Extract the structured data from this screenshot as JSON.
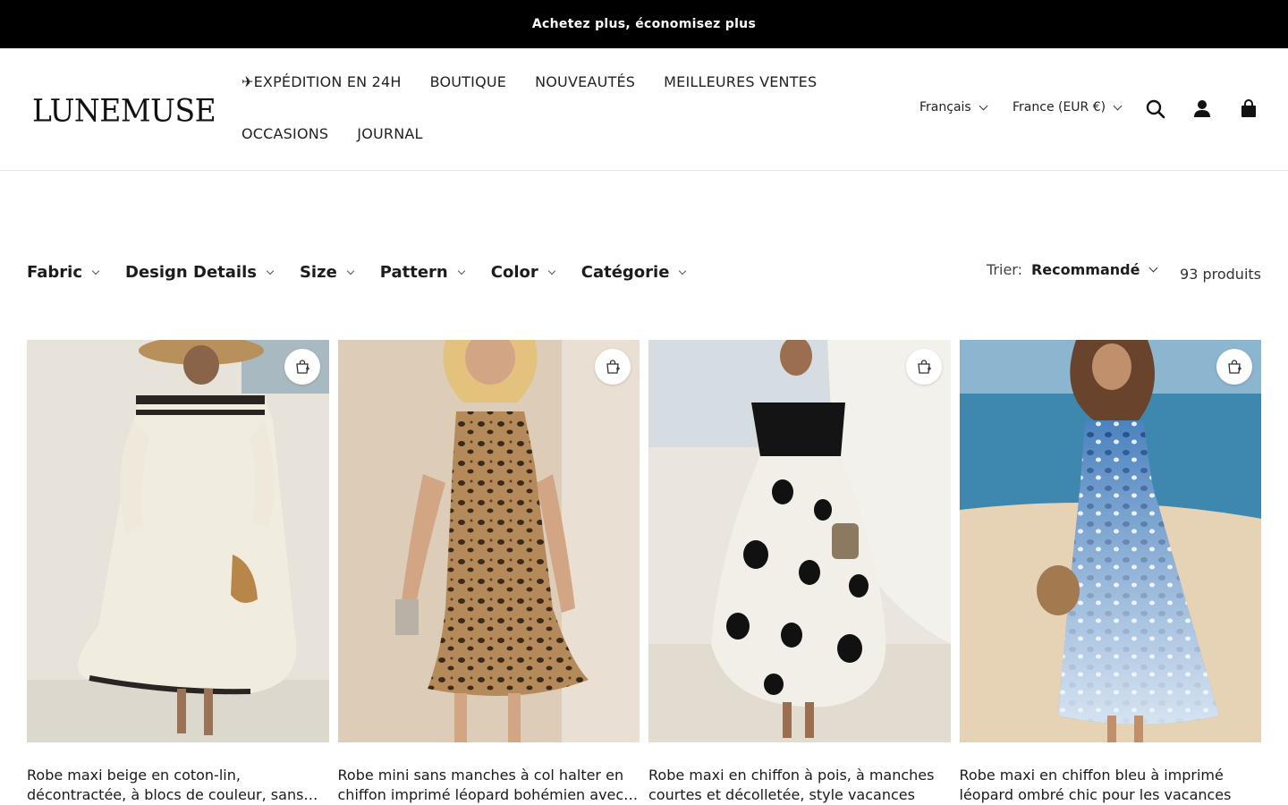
{
  "announcement": "Achetez plus, économisez plus",
  "brand": {
    "logo_text": "LUNEMUSE"
  },
  "nav": {
    "row1": [
      "✈EXPÉDITION EN 24H",
      "BOUTIQUE",
      "NOUVEAUTÉS",
      "MEILLEURES VENTES"
    ],
    "row2": [
      "OCCASIONS",
      "JOURNAL"
    ]
  },
  "header": {
    "language": "Français",
    "country": "France (EUR €)",
    "icons": [
      "search-icon",
      "account-icon",
      "cart-icon"
    ]
  },
  "filters": [
    "Fabric",
    "Design Details",
    "Size",
    "Pattern",
    "Color",
    "Catégorie"
  ],
  "sort": {
    "label": "Trier:",
    "value": "Recommandé"
  },
  "product_count": "93 produits",
  "products": [
    {
      "title": "Robe maxi beige en coton-lin, décontractée, à blocs de couleur, sans manches",
      "colors": {
        "bg": "#e9e5dc",
        "dress": "#f1ece0",
        "accent": "#2a2522"
      }
    },
    {
      "title": "Robe mini sans manches à col halter en chiffon imprimé léopard bohémien avec volants",
      "colors": {
        "bg": "#d9c8b4",
        "dress": "#b58a5a",
        "accent": "#3b2a1a"
      }
    },
    {
      "title": "Robe maxi en chiffon à pois, à manches courtes et décolletée, style vacances",
      "colors": {
        "bg": "#e6e2db",
        "dress": "#f2efe8",
        "accent": "#111111"
      }
    },
    {
      "title": "Robe maxi en chiffon bleu à imprimé léopard ombré chic pour les vacances",
      "colors": {
        "bg": "#6aa3c4",
        "dress": "#3a72b0",
        "accent": "#e8d9c0"
      }
    }
  ]
}
